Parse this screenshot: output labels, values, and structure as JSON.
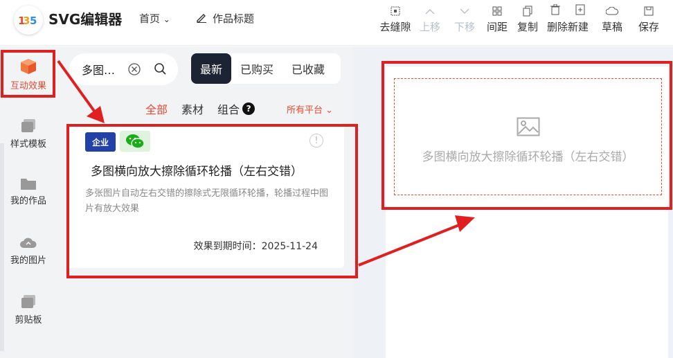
{
  "header": {
    "app_name": "SVG编辑器",
    "nav_home": "首页",
    "work_title": "作品标题",
    "tools": [
      {
        "label": "去缝隙",
        "icon": "gap-icon",
        "disabled": false
      },
      {
        "label": "上移",
        "icon": "chevron-up-icon",
        "disabled": true
      },
      {
        "label": "下移",
        "icon": "chevron-down-icon",
        "disabled": true
      },
      {
        "label": "间距",
        "icon": "spacing-icon",
        "disabled": false
      },
      {
        "label": "复制",
        "icon": "copy-icon",
        "disabled": false
      },
      {
        "label": "删除新建",
        "icon": "trash-icon",
        "disabled": false
      },
      {
        "label": "草稿",
        "icon": "cloud-icon",
        "disabled": false
      },
      {
        "label": "保存",
        "icon": "save-icon",
        "disabled": false
      }
    ]
  },
  "rail": {
    "items": [
      {
        "label": "互动效果",
        "icon": "cube-icon",
        "active": true
      },
      {
        "label": "样式模板",
        "icon": "template-icon",
        "active": false
      },
      {
        "label": "我的作品",
        "icon": "folder-icon",
        "active": false
      },
      {
        "label": "我的图片",
        "icon": "cloud-upload-icon",
        "active": false
      },
      {
        "label": "剪贴板",
        "icon": "clipboard-icon",
        "active": false
      }
    ]
  },
  "search": {
    "value": "多图…"
  },
  "segments": [
    "最新",
    "已购买",
    "已收藏"
  ],
  "filters": {
    "all": "全部",
    "material": "素材",
    "combo": "组合",
    "help": "?",
    "platform": "所有平台"
  },
  "card": {
    "badge_enterprise": "企业",
    "title": "多图横向放大擦除循环轮播（左右交错）",
    "description": "多张图片自动左右交错的擦除式无限循环轮播，轮播过程中图片有放大效果",
    "expiry": "效果到期时间：2025-11-24",
    "info": "!"
  },
  "canvas": {
    "placeholder_text": "多图横向放大擦除循环轮播（左右交错）"
  },
  "colors": {
    "accent": "#e84a2f",
    "annotation": "#e02020",
    "dark_segment": "#1c2333"
  }
}
